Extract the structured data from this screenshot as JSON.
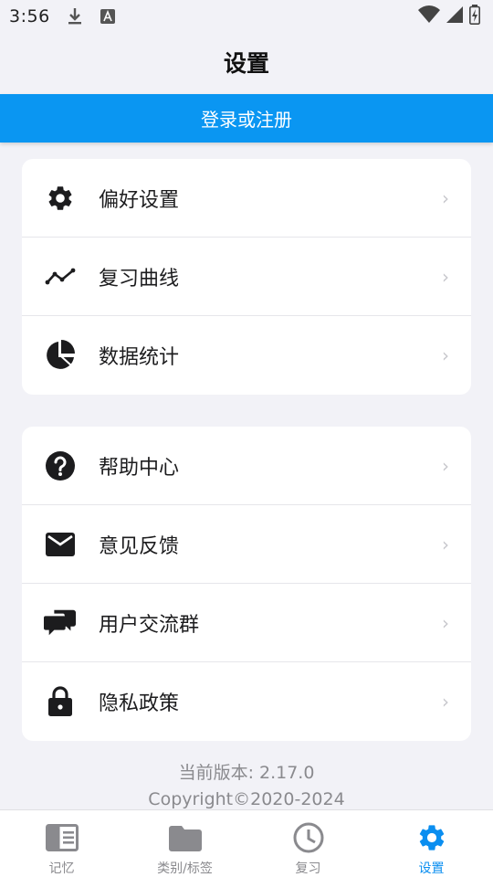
{
  "status_bar": {
    "time": "3:56"
  },
  "header": {
    "title": "设置"
  },
  "login": {
    "label": "登录或注册"
  },
  "group1": [
    {
      "icon": "gear-icon",
      "label": "偏好设置"
    },
    {
      "icon": "line-chart-icon",
      "label": "复习曲线"
    },
    {
      "icon": "pie-chart-icon",
      "label": "数据统计"
    }
  ],
  "group2": [
    {
      "icon": "help-icon",
      "label": "帮助中心"
    },
    {
      "icon": "mail-icon",
      "label": "意见反馈"
    },
    {
      "icon": "chat-icon",
      "label": "用户交流群"
    },
    {
      "icon": "lock-icon",
      "label": "隐私政策"
    }
  ],
  "chevron": "›",
  "version": {
    "line1": "当前版本: 2.17.0",
    "line2": "Copyright©2020-2024"
  },
  "tabbar": [
    {
      "icon": "memo-icon",
      "label": "记忆"
    },
    {
      "icon": "folder-icon",
      "label": "类别/标签"
    },
    {
      "icon": "clock-icon",
      "label": "复习"
    },
    {
      "icon": "gear-icon",
      "label": "设置",
      "active": true
    }
  ],
  "colors": {
    "accent": "#0a96f2",
    "background": "#f2f2f7",
    "tab_active": "#0a8ef0",
    "tab_inactive": "#8a8a8e"
  }
}
